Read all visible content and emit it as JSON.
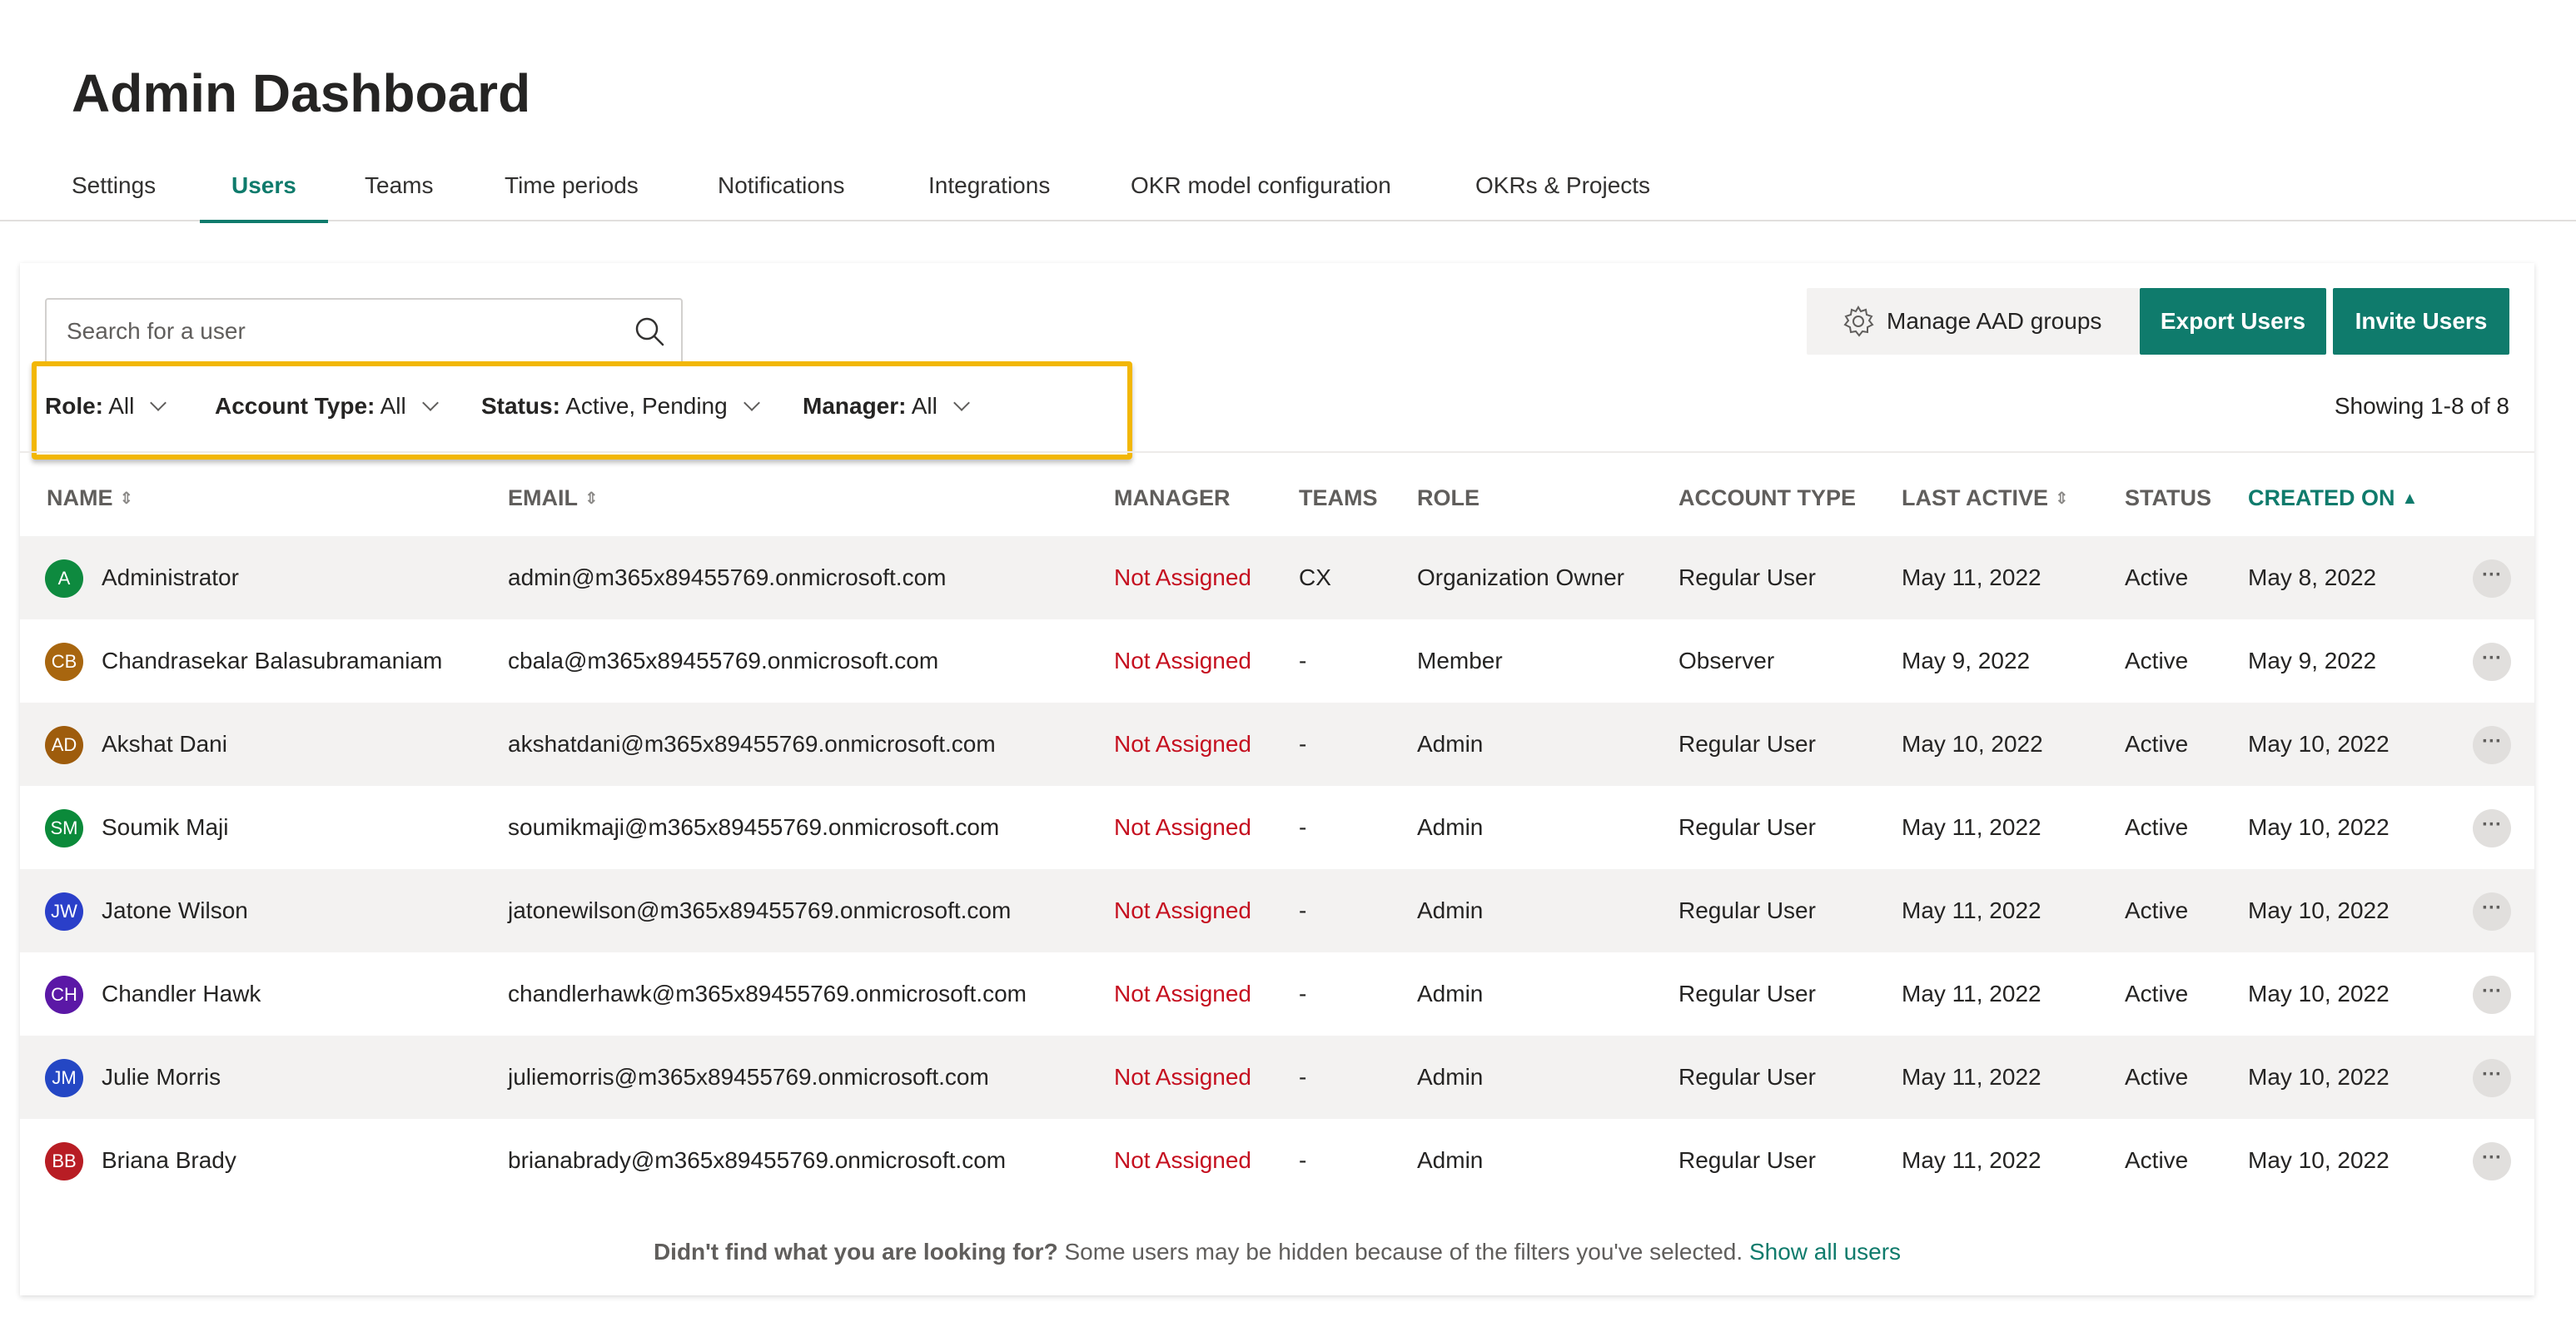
{
  "page": {
    "title": "Admin Dashboard"
  },
  "tabs": [
    {
      "label": "Settings"
    },
    {
      "label": "Users"
    },
    {
      "label": "Teams"
    },
    {
      "label": "Time periods"
    },
    {
      "label": "Notifications"
    },
    {
      "label": "Integrations"
    },
    {
      "label": "OKR model configuration"
    },
    {
      "label": "OKRs & Projects"
    }
  ],
  "active_tab": "Users",
  "search": {
    "placeholder": "Search for a user",
    "value": ""
  },
  "filters": [
    {
      "label": "Role:",
      "value": "All"
    },
    {
      "label": "Account Type:",
      "value": "All"
    },
    {
      "label": "Status:",
      "value": "Active, Pending"
    },
    {
      "label": "Manager:",
      "value": "All"
    }
  ],
  "toolbar": {
    "manage_label": "Manage AAD groups",
    "export_label": "Export Users",
    "invite_label": "Invite Users"
  },
  "showing": "Showing 1-8 of 8",
  "table": {
    "columns": [
      {
        "label": "NAME",
        "sortable": true
      },
      {
        "label": "EMAIL",
        "sortable": true
      },
      {
        "label": "MANAGER",
        "sortable": false
      },
      {
        "label": "TEAMS",
        "sortable": false
      },
      {
        "label": "ROLE",
        "sortable": false
      },
      {
        "label": "ACCOUNT TYPE",
        "sortable": false
      },
      {
        "label": "LAST ACTIVE",
        "sortable": true
      },
      {
        "label": "STATUS",
        "sortable": false
      },
      {
        "label": "CREATED ON",
        "sortable": true,
        "sorted": "ascending"
      }
    ],
    "rows": [
      {
        "initials": "A",
        "avatar_color": "#0e8a3f",
        "name": "Administrator",
        "email": "admin@m365x89455769.onmicrosoft.com",
        "manager": "Not Assigned",
        "teams": "CX",
        "role": "Organization Owner",
        "account_type": "Regular User",
        "last_active": "May 11, 2022",
        "status": "Active",
        "created_on": "May 8, 2022"
      },
      {
        "initials": "CB",
        "avatar_color": "#a8660f",
        "name": "Chandrasekar Balasubramaniam",
        "email": "cbala@m365x89455769.onmicrosoft.com",
        "manager": "Not Assigned",
        "teams": "-",
        "role": "Member",
        "account_type": "Observer",
        "last_active": "May 9, 2022",
        "status": "Active",
        "created_on": "May 9, 2022"
      },
      {
        "initials": "AD",
        "avatar_color": "#9e5c0c",
        "name": "Akshat Dani",
        "email": "akshatdani@m365x89455769.onmicrosoft.com",
        "manager": "Not Assigned",
        "teams": "-",
        "role": "Admin",
        "account_type": "Regular User",
        "last_active": "May 10, 2022",
        "status": "Active",
        "created_on": "May 10, 2022"
      },
      {
        "initials": "SM",
        "avatar_color": "#0b8a3a",
        "name": "Soumik Maji",
        "email": "soumikmaji@m365x89455769.onmicrosoft.com",
        "manager": "Not Assigned",
        "teams": "-",
        "role": "Admin",
        "account_type": "Regular User",
        "last_active": "May 11, 2022",
        "status": "Active",
        "created_on": "May 10, 2022"
      },
      {
        "initials": "JW",
        "avatar_color": "#2a3fc9",
        "name": "Jatone Wilson",
        "email": "jatonewilson@m365x89455769.onmicrosoft.com",
        "manager": "Not Assigned",
        "teams": "-",
        "role": "Admin",
        "account_type": "Regular User",
        "last_active": "May 11, 2022",
        "status": "Active",
        "created_on": "May 10, 2022"
      },
      {
        "initials": "CH",
        "avatar_color": "#5b18a6",
        "name": "Chandler Hawk",
        "email": "chandlerhawk@m365x89455769.onmicrosoft.com",
        "manager": "Not Assigned",
        "teams": "-",
        "role": "Admin",
        "account_type": "Regular User",
        "last_active": "May 11, 2022",
        "status": "Active",
        "created_on": "May 10, 2022"
      },
      {
        "initials": "JM",
        "avatar_color": "#2447c4",
        "name": "Julie Morris",
        "email": "juliemorris@m365x89455769.onmicrosoft.com",
        "manager": "Not Assigned",
        "teams": "-",
        "role": "Admin",
        "account_type": "Regular User",
        "last_active": "May 11, 2022",
        "status": "Active",
        "created_on": "May 10, 2022"
      },
      {
        "initials": "BB",
        "avatar_color": "#b81d24",
        "name": "Briana Brady",
        "email": "brianabrady@m365x89455769.onmicrosoft.com",
        "manager": "Not Assigned",
        "teams": "-",
        "role": "Admin",
        "account_type": "Regular User",
        "last_active": "May 11, 2022",
        "status": "Active",
        "created_on": "May 10, 2022"
      }
    ]
  },
  "footer": {
    "question": "Didn't find what you are looking for?",
    "message": "Some users may be hidden because of the filters you've selected.",
    "link": "Show all users"
  },
  "colors": {
    "accent": "#0f7b6c",
    "highlight": "#f2b705",
    "manager_unassigned": "#c50f1f"
  }
}
